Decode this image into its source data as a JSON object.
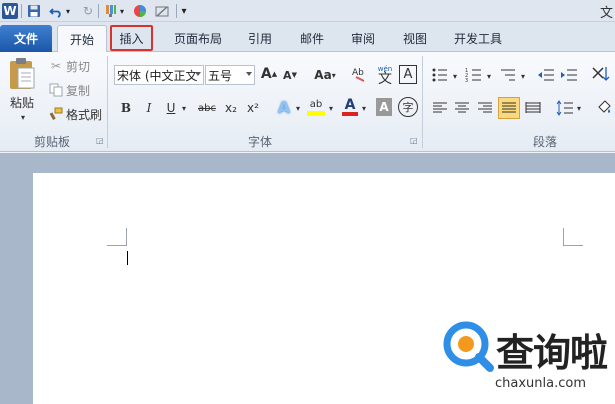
{
  "title_fragment": "文",
  "tabs": {
    "file": "文件",
    "home": "开始",
    "insert": "插入",
    "page_layout": "页面布局",
    "references": "引用",
    "mailings": "邮件",
    "review": "审阅",
    "view": "视图",
    "developer": "开发工具"
  },
  "clipboard": {
    "paste": "粘贴",
    "cut": "剪切",
    "copy": "复制",
    "format_painter": "格式刷",
    "group_label": "剪贴板"
  },
  "font": {
    "font_name": "宋体 (中文正文",
    "font_size": "五号",
    "group_label": "字体",
    "grow": "A",
    "shrink": "A",
    "change_case": "Aa",
    "phonetic": "wén",
    "phonetic_char": "文",
    "border_char": "A",
    "bold": "B",
    "italic": "I",
    "underline": "U",
    "strike": "abc",
    "subscript": "x₂",
    "superscript": "x²",
    "text_effect": "A",
    "highlight": "ab",
    "font_color": "A",
    "char_shading": "A",
    "enclose": "字"
  },
  "paragraph": {
    "group_label": "段落"
  },
  "watermark": {
    "brand": "查询啦",
    "url": "chaxunla.com"
  },
  "colors": {
    "accent_blue": "#2b6cc4",
    "highlight_box": "#d8322f",
    "font_red": "#d22",
    "highlight_yellow": "#ffff00",
    "watermark_blue": "#2f8fe6"
  }
}
